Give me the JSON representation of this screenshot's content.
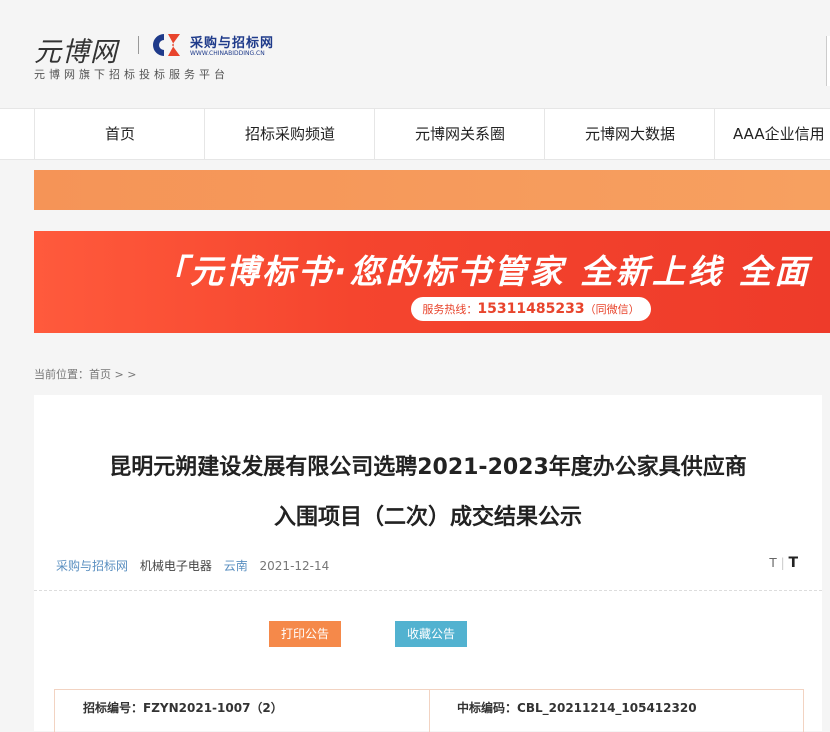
{
  "header": {
    "logo_text": "元博网",
    "partner_name": "采购与招标网",
    "partner_domain": "WWW.CHINABIDDING.CN",
    "slogan": "元博网旗下招标投标服务平台"
  },
  "nav": {
    "items": [
      "首页",
      "招标采购频道",
      "元博网关系圈",
      "元博网大数据",
      "AAA企业信用"
    ]
  },
  "banner": {
    "headline": "「元博标书·您的标书管家 全新上线 全面",
    "hotline_label": "服务热线：",
    "hotline_number": "15311485233",
    "hotline_note": "（同微信）"
  },
  "breadcrumb": {
    "label": "当前位置：",
    "home": "首页",
    "sep": "> >"
  },
  "article": {
    "title_line1": "昆明元朔建设发展有限公司选聘2021-2023年度办公家具供应商",
    "title_line2": "入围项目（二次）成交结果公示",
    "source": "采购与招标网",
    "category": "机械电子电器",
    "region": "云南",
    "date": "2021-12-14",
    "font_small": "T",
    "font_sep": "|",
    "font_large": "T",
    "print_label": "打印公告",
    "favorite_label": "收藏公告",
    "tender_no_label": "招标编号：",
    "tender_no": "FZYN2021-1007（2）",
    "award_code_label": "中标编码：",
    "award_code": "CBL_20211214_105412320"
  },
  "colors": {
    "accent_orange": "#f5894a",
    "accent_blue": "#52b2d0",
    "banner_red": "#f5452e"
  }
}
